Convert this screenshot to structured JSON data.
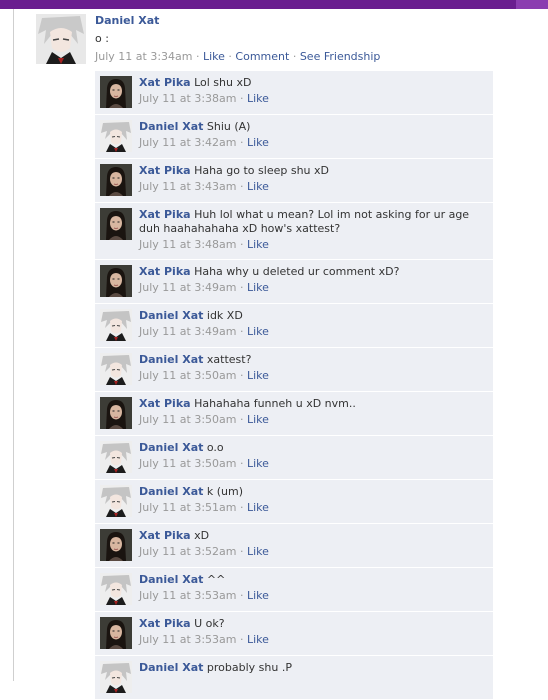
{
  "post": {
    "author": "Daniel Xat",
    "text": "o :",
    "time": "July 11 at 3:34am",
    "like_label": "Like",
    "comment_label": "Comment",
    "friendship_label": "See Friendship",
    "separator": "·"
  },
  "comment_like_label": "Like",
  "comment_separator": "·",
  "comments": [
    {
      "name": "Xat Pika",
      "text": "Lol shu xD",
      "time": "July 11 at 3:38am",
      "avatar": "girl-avatar"
    },
    {
      "name": "Daniel Xat",
      "text": "Shiu (A)",
      "time": "July 11 at 3:42am",
      "avatar": "anime-boy-avatar"
    },
    {
      "name": "Xat Pika",
      "text": "Haha go to sleep shu xD",
      "time": "July 11 at 3:43am",
      "avatar": "girl-avatar"
    },
    {
      "name": "Xat Pika",
      "text": "Huh lol what u mean? Lol im not asking for ur age duh haahahahaha xD how's xattest?",
      "time": "July 11 at 3:48am",
      "avatar": "girl-avatar"
    },
    {
      "name": "Xat Pika",
      "text": "Haha why u deleted ur comment xD?",
      "time": "July 11 at 3:49am",
      "avatar": "girl-avatar"
    },
    {
      "name": "Daniel Xat",
      "text": "idk XD",
      "time": "July 11 at 3:49am",
      "avatar": "anime-boy-avatar"
    },
    {
      "name": "Daniel Xat",
      "text": "xattest?",
      "time": "July 11 at 3:50am",
      "avatar": "anime-boy-avatar"
    },
    {
      "name": "Xat Pika",
      "text": "Hahahaha funneh u xD nvm..",
      "time": "July 11 at 3:50am",
      "avatar": "girl-avatar"
    },
    {
      "name": "Daniel Xat",
      "text": "o.o",
      "time": "July 11 at 3:50am",
      "avatar": "anime-boy-avatar"
    },
    {
      "name": "Daniel Xat",
      "text": "k (um)",
      "time": "July 11 at 3:51am",
      "avatar": "anime-boy-avatar"
    },
    {
      "name": "Xat Pika",
      "text": "xD",
      "time": "July 11 at 3:52am",
      "avatar": "girl-avatar"
    },
    {
      "name": "Daniel Xat",
      "text": "^^",
      "time": "July 11 at 3:53am",
      "avatar": "anime-boy-avatar"
    },
    {
      "name": "Xat Pika",
      "text": "U ok?",
      "time": "July 11 at 3:53am",
      "avatar": "girl-avatar"
    },
    {
      "name": "Daniel Xat",
      "text": "probably shu .P",
      "time": "",
      "avatar": "anime-boy-avatar"
    }
  ],
  "colors": {
    "link": "#3b5998",
    "comment_bg": "#edeff4",
    "meta": "#999999",
    "topbar": "#6a1d8f"
  }
}
